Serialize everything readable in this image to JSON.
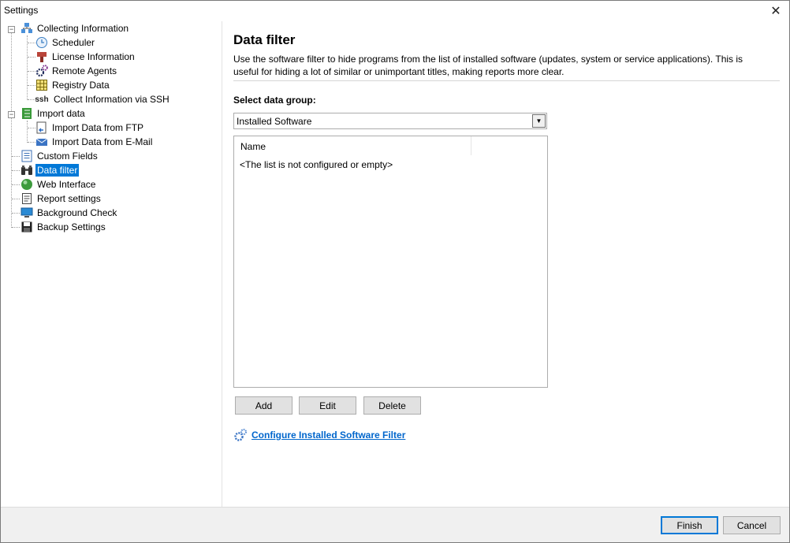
{
  "window": {
    "title": "Settings",
    "close_glyph": "✕"
  },
  "tree": {
    "items": [
      {
        "label": "Collecting Information",
        "icon": "network-icon"
      },
      {
        "label": "Scheduler",
        "icon": "clock-icon"
      },
      {
        "label": "License Information",
        "icon": "license-icon"
      },
      {
        "label": "Remote Agents",
        "icon": "gears-icon"
      },
      {
        "label": "Registry Data",
        "icon": "grid-icon"
      },
      {
        "label": "Collect Information via SSH",
        "icon": "ssh-icon",
        "icon_text": "ssh"
      },
      {
        "label": "Import data",
        "icon": "import-icon"
      },
      {
        "label": "Import Data from FTP",
        "icon": "ftp-import-icon"
      },
      {
        "label": "Import Data from E-Mail",
        "icon": "email-import-icon"
      },
      {
        "label": "Custom Fields",
        "icon": "list-icon"
      },
      {
        "label": "Data filter",
        "icon": "binoculars-icon",
        "selected": true
      },
      {
        "label": "Web Interface",
        "icon": "globe-icon"
      },
      {
        "label": "Report settings",
        "icon": "report-icon"
      },
      {
        "label": "Background Check",
        "icon": "monitor-icon"
      },
      {
        "label": "Backup Settings",
        "icon": "floppy-icon"
      }
    ],
    "expander_glyph": "−"
  },
  "content": {
    "heading": "Data filter",
    "description": "Use the software filter to hide programs from the list of installed software (updates, system or service applications). This is useful for hiding a lot of similar or unimportant titles, making reports more clear.",
    "group_label": "Select data group:",
    "group_value": "Installed Software",
    "dropdown_arrow": "▼",
    "list": {
      "column_name": "Name",
      "empty_text": "<The list is not configured or empty>"
    },
    "buttons": {
      "add": "Add",
      "edit": "Edit",
      "delete": "Delete"
    },
    "configure_link": "Configure Installed Software Filter"
  },
  "footer": {
    "finish": "Finish",
    "cancel": "Cancel"
  },
  "colors": {
    "selection": "#0078d7",
    "link": "#0066cc"
  }
}
